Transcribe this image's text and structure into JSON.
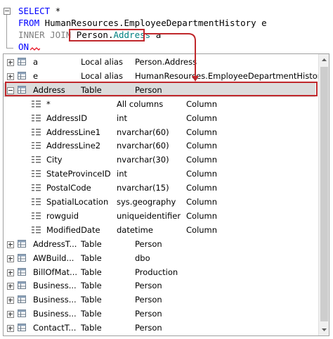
{
  "editor": {
    "line1": {
      "kw": "SELECT",
      "rest": " *"
    },
    "line2": {
      "kw": "FROM",
      "rest": " HumanResources.EmployeeDepartmentHistory e"
    },
    "line3": {
      "kw": "INNER JOIN",
      "obj_schema": "Person",
      "obj_dot": ".",
      "obj_name": "Address",
      "alias": " a"
    },
    "line4": {
      "kw": "ON"
    }
  },
  "tree": {
    "rows": [
      {
        "name": "a",
        "type": "Local alias",
        "info": "Person.Address",
        "kind": "table",
        "expander": "plus"
      },
      {
        "name": "e",
        "type": "Local alias",
        "info": "HumanResources.EmployeeDepartmentHistory",
        "kind": "table",
        "expander": "plus"
      },
      {
        "name": "Address",
        "type": "Table",
        "info": "Person",
        "kind": "table",
        "expander": "minus",
        "selected": true
      },
      {
        "name": "*",
        "type": "All columns",
        "info": "Column",
        "kind": "column"
      },
      {
        "name": "AddressID",
        "type": "int",
        "info": "Column",
        "kind": "column"
      },
      {
        "name": "AddressLine1",
        "type": "nvarchar(60)",
        "info": "Column",
        "kind": "column"
      },
      {
        "name": "AddressLine2",
        "type": "nvarchar(60)",
        "info": "Column",
        "kind": "column"
      },
      {
        "name": "City",
        "type": "nvarchar(30)",
        "info": "Column",
        "kind": "column"
      },
      {
        "name": "StateProvinceID",
        "type": "int",
        "info": "Column",
        "kind": "column"
      },
      {
        "name": "PostalCode",
        "type": "nvarchar(15)",
        "info": "Column",
        "kind": "column"
      },
      {
        "name": "SpatialLocation",
        "type": "sys.geography",
        "info": "Column",
        "kind": "column"
      },
      {
        "name": "rowguid",
        "type": "uniqueidentifier",
        "info": "Column",
        "kind": "column"
      },
      {
        "name": "ModifiedDate",
        "type": "datetime",
        "info": "Column",
        "kind": "column"
      },
      {
        "name": "AddressT...",
        "type": "Table",
        "info": "Person",
        "kind": "table",
        "expander": "plus"
      },
      {
        "name": "AWBuild...",
        "type": "Table",
        "info": "dbo",
        "kind": "table",
        "expander": "plus"
      },
      {
        "name": "BillOfMat...",
        "type": "Table",
        "info": "Production",
        "kind": "table",
        "expander": "plus"
      },
      {
        "name": "Business...",
        "type": "Table",
        "info": "Person",
        "kind": "table",
        "expander": "plus"
      },
      {
        "name": "Business...",
        "type": "Table",
        "info": "Person",
        "kind": "table",
        "expander": "plus"
      },
      {
        "name": "Business...",
        "type": "Table",
        "info": "Person",
        "kind": "table",
        "expander": "plus"
      },
      {
        "name": "ContactT...",
        "type": "Table",
        "info": "Person",
        "kind": "table",
        "expander": "plus"
      }
    ]
  },
  "colors": {
    "keyword": "#0000ff",
    "identifier": "#008080",
    "annotation": "#c0282c",
    "selection": "#dcdcdc"
  },
  "icons": {
    "table": "table-icon",
    "column": "column-icon",
    "expander": "expand-collapse-icon"
  }
}
